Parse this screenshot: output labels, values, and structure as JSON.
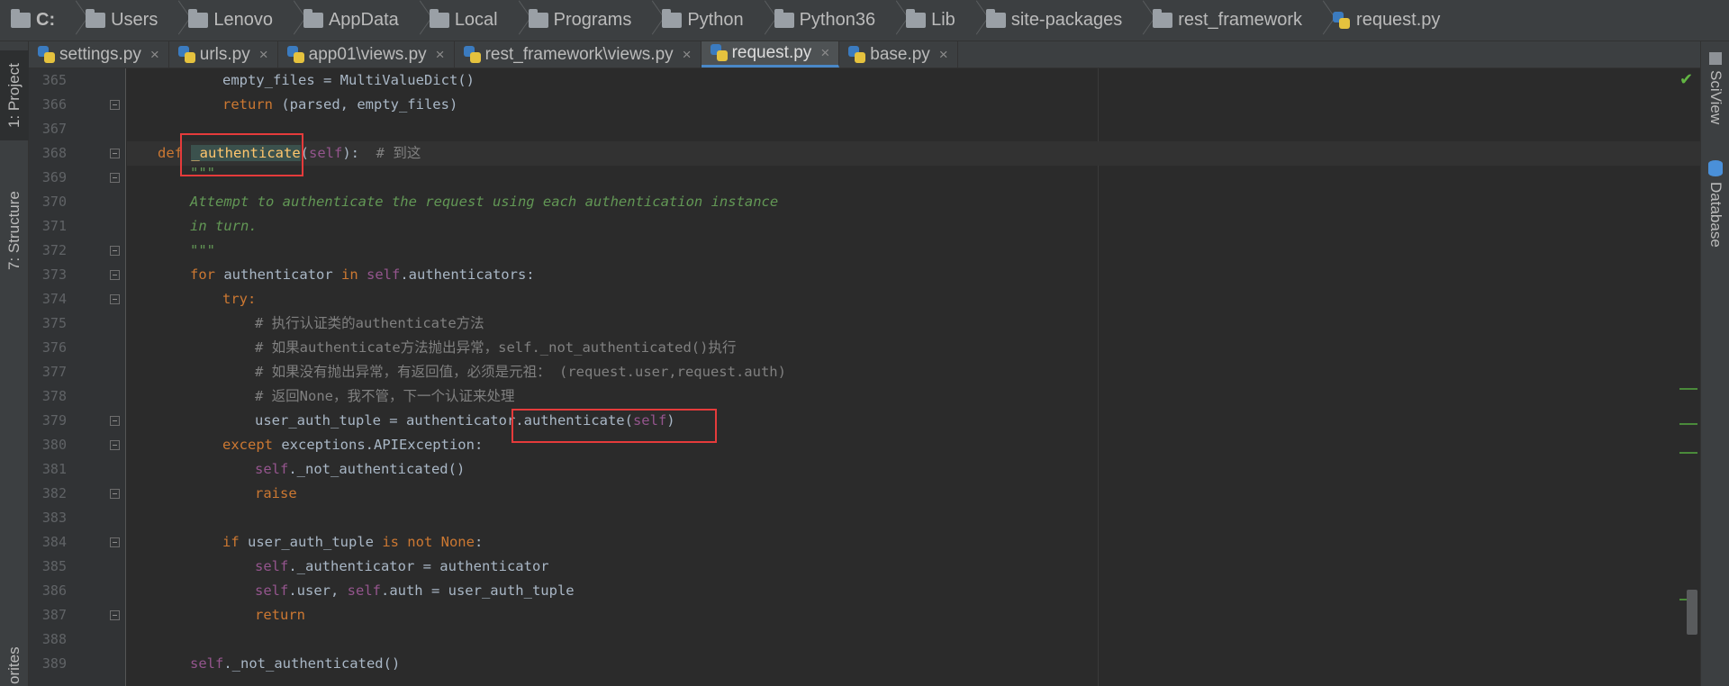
{
  "breadcrumb": [
    {
      "label": "C:",
      "icon": "folder-icon"
    },
    {
      "label": "Users",
      "icon": "folder-icon"
    },
    {
      "label": "Lenovo",
      "icon": "folder-icon"
    },
    {
      "label": "AppData",
      "icon": "folder-icon"
    },
    {
      "label": "Local",
      "icon": "folder-icon"
    },
    {
      "label": "Programs",
      "icon": "folder-icon"
    },
    {
      "label": "Python",
      "icon": "folder-icon"
    },
    {
      "label": "Python36",
      "icon": "folder-icon"
    },
    {
      "label": "Lib",
      "icon": "folder-icon"
    },
    {
      "label": "site-packages",
      "icon": "folder-icon"
    },
    {
      "label": "rest_framework",
      "icon": "folder-icon"
    },
    {
      "label": "request.py",
      "icon": "python-file-icon"
    }
  ],
  "left_tools": {
    "project": "1: Project",
    "structure": "7: Structure",
    "favorites": "orites"
  },
  "right_tools": {
    "sciview": "SciView",
    "database": "Database"
  },
  "tabs": [
    {
      "label": "settings.py",
      "active": false
    },
    {
      "label": "urls.py",
      "active": false
    },
    {
      "label": "app01\\views.py",
      "active": false
    },
    {
      "label": "rest_framework\\views.py",
      "active": false
    },
    {
      "label": "request.py",
      "active": true
    },
    {
      "label": "base.py",
      "active": false
    }
  ],
  "tab_close_glyph": "×",
  "line_numbers": [
    "365",
    "366",
    "367",
    "368",
    "369",
    "370",
    "371",
    "372",
    "373",
    "374",
    "375",
    "376",
    "377",
    "378",
    "379",
    "380",
    "381",
    "382",
    "383",
    "384",
    "385",
    "386",
    "387",
    "388",
    "389"
  ],
  "code": {
    "l365": "empty_files = MultiValueDict()",
    "l366_kw": "return",
    "l366_rest": " (parsed, empty_files)",
    "l368_def": "def",
    "l368_fn": "_authenticate",
    "l368_open": "(",
    "l368_self": "self",
    "l368_close": "):",
    "l368_comment": "  # 到这",
    "l369": "\"\"\"",
    "l370": "Attempt to authenticate the request using each authentication instance",
    "l371": "in turn.",
    "l372": "\"\"\"",
    "l373_for": "for",
    "l373_mid": " authenticator ",
    "l373_in": "in",
    "l373_self": " self",
    "l373_rest": ".authenticators:",
    "l374": "try:",
    "l375": "# 执行认证类的authenticate方法",
    "l376": "# 如果authenticate方法抛出异常，self._not_authenticated()执行",
    "l377": "# 如果没有抛出异常，有返回值，必须是元祖： (request.user,request.auth)",
    "l378": "# 返回None，我不管，下一个认证来处理",
    "l379_a": "user_auth_tuple = authenticator.",
    "l379_b": "authenticate(",
    "l379_self": "self",
    "l379_c": ")",
    "l380_kw": "except",
    "l380_rest": " exceptions.APIException:",
    "l381_self": "self",
    "l381_rest": "._not_authenticated()",
    "l382": "raise",
    "l384_if": "if",
    "l384_mid": " user_auth_tuple ",
    "l384_isnot": "is not None",
    "l384_end": ":",
    "l385_self": "self",
    "l385_rest": "._authenticator = authenticator",
    "l386_self1": "self",
    "l386_mid": ".user, ",
    "l386_self2": "self",
    "l386_rest": ".auth = user_auth_tuple",
    "l387": "return",
    "l389_self": "self",
    "l389_rest": "._not_authenticated()"
  },
  "colors": {
    "keyword": "#cc7832",
    "self": "#94558d",
    "comment": "#808080",
    "docstring": "#629755",
    "function": "#ffc66d",
    "highlight_box": "#e53b3b"
  }
}
